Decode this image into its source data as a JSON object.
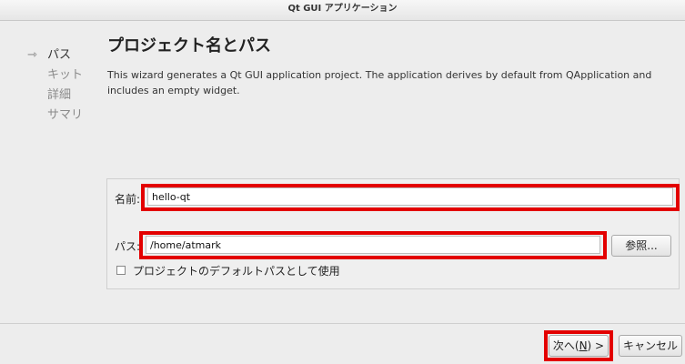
{
  "window": {
    "title": "Qt GUI アプリケーション"
  },
  "nav": {
    "items": [
      {
        "label": "パス",
        "active": true
      },
      {
        "label": "キット",
        "active": false
      },
      {
        "label": "詳細",
        "active": false
      },
      {
        "label": "サマリ",
        "active": false
      }
    ],
    "active_icon": "arrow-right-icon"
  },
  "page": {
    "title": "プロジェクト名とパス",
    "description": "This wizard generates a Qt GUI application project. The application derives by default from QApplication and includes an empty widget."
  },
  "form": {
    "name_label": "名前:",
    "name_value": "hello-qt",
    "path_label": "パス:",
    "path_value": "/home/atmark",
    "browse_label": "参照...",
    "default_path_checkbox_label": "プロジェクトのデフォルトパスとして使用",
    "default_path_checked": false
  },
  "footer": {
    "next_label_prefix": "次へ(",
    "next_mnemonic": "N",
    "next_label_suffix": ") >",
    "cancel_label": "キャンセル"
  },
  "highlight_color": "#e30000"
}
